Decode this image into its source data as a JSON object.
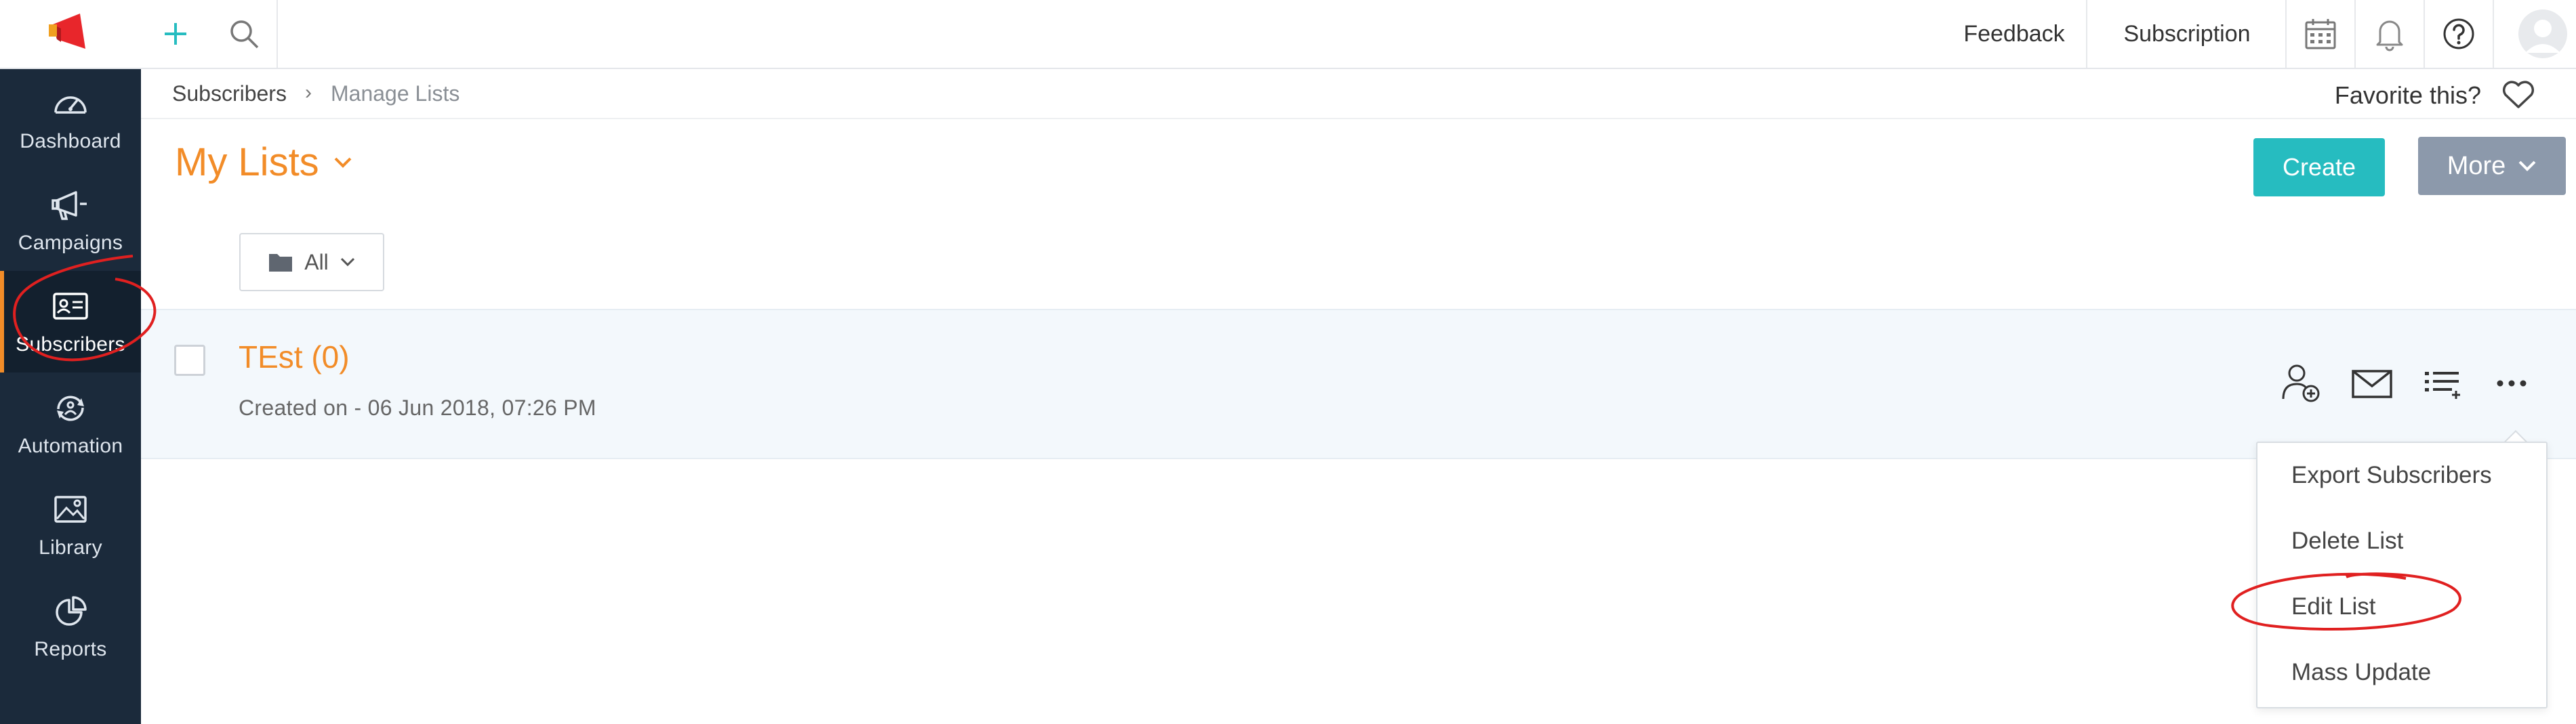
{
  "sidebar": {
    "items": [
      {
        "label": "Dashboard",
        "icon": "gauge-icon"
      },
      {
        "label": "Campaigns",
        "icon": "megaphone-icon"
      },
      {
        "label": "Subscribers",
        "icon": "id-card-icon",
        "active": true
      },
      {
        "label": "Automation",
        "icon": "automation-icon"
      },
      {
        "label": "Library",
        "icon": "image-icon"
      },
      {
        "label": "Reports",
        "icon": "pie-chart-icon"
      }
    ]
  },
  "topbar": {
    "feedback": "Feedback",
    "subscription": "Subscription"
  },
  "breadcrumb": {
    "parent": "Subscribers",
    "separator": "›",
    "current": "Manage Lists"
  },
  "favorite": {
    "label": "Favorite this?"
  },
  "header": {
    "title": "My Lists",
    "create": "Create",
    "more": "More"
  },
  "filter": {
    "label": "All"
  },
  "list": {
    "rows": [
      {
        "title": "TEst (0)",
        "created": "Created on - 06 Jun 2018, 07:26 PM"
      }
    ]
  },
  "menu": {
    "items": [
      "Export Subscribers",
      "Delete List",
      "Edit List",
      "Mass Update"
    ]
  },
  "colors": {
    "accent": "#f28c28",
    "create": "#26bcc0",
    "more": "#8c99ab",
    "sidebar": "#1b2a3b",
    "annotation": "#e02020"
  }
}
